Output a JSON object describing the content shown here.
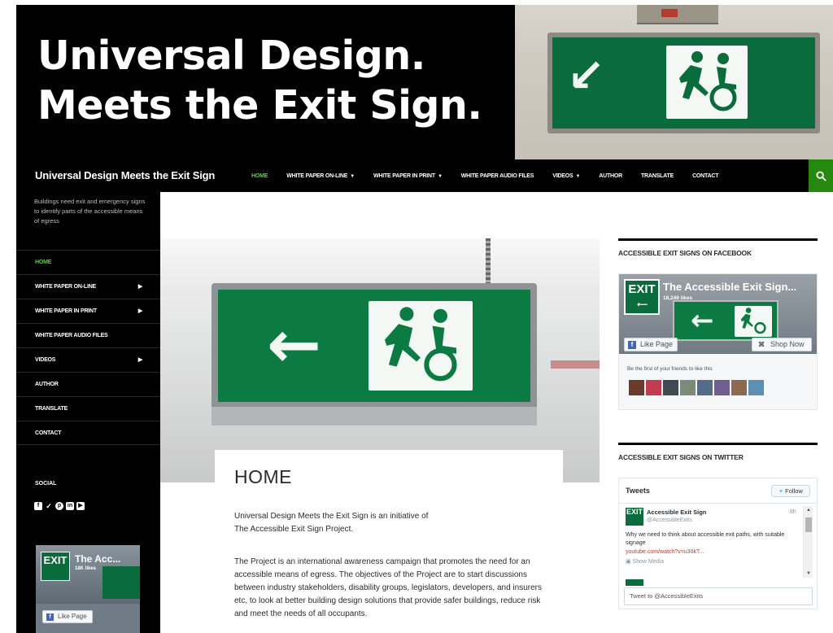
{
  "banner": {
    "title": "Universal Design.\nMeets the Exit Sign."
  },
  "site": {
    "title": "Universal Design Meets the Exit Sign",
    "tagline": "Buildings need exit and emergency signs to identify parts of the accessible means of egress"
  },
  "colors": {
    "accent": "#24890d",
    "active_link": "#55d737",
    "exit_green": "#0a6b3c"
  },
  "top_menu": [
    {
      "label": "HOME",
      "active": true,
      "has_submenu": false
    },
    {
      "label": "WHITE PAPER ON-LINE",
      "active": false,
      "has_submenu": true
    },
    {
      "label": "WHITE PAPER IN PRINT",
      "active": false,
      "has_submenu": true
    },
    {
      "label": "WHITE PAPER AUDIO FILES",
      "active": false,
      "has_submenu": false
    },
    {
      "label": "VIDEOS",
      "active": false,
      "has_submenu": true
    },
    {
      "label": "AUTHOR",
      "active": false,
      "has_submenu": false
    },
    {
      "label": "TRANSLATE",
      "active": false,
      "has_submenu": false
    },
    {
      "label": "CONTACT",
      "active": false,
      "has_submenu": false
    }
  ],
  "search_icon": "search-icon",
  "side_menu": [
    {
      "label": "HOME",
      "active": true,
      "has_submenu": false
    },
    {
      "label": "WHITE PAPER ON-LINE",
      "active": false,
      "has_submenu": true
    },
    {
      "label": "WHITE PAPER IN PRINT",
      "active": false,
      "has_submenu": true
    },
    {
      "label": "WHITE PAPER AUDIO FILES",
      "active": false,
      "has_submenu": false
    },
    {
      "label": "VIDEOS",
      "active": false,
      "has_submenu": true
    },
    {
      "label": "AUTHOR",
      "active": false,
      "has_submenu": false
    },
    {
      "label": "TRANSLATE",
      "active": false,
      "has_submenu": false
    },
    {
      "label": "CONTACT",
      "active": false,
      "has_submenu": false
    }
  ],
  "social": {
    "title": "SOCIAL",
    "icons": [
      "facebook-icon",
      "twitter-icon",
      "pinterest-icon",
      "linkedin-icon",
      "youtube-icon"
    ]
  },
  "side_fb": {
    "name": "The Acc...",
    "likes": "18K likes",
    "like_label": "Like Page",
    "logo_text": "EXIT"
  },
  "main": {
    "page_title": "HOME",
    "intro": "Universal Design Meets the Exit Sign is an initiative of\nThe Accessible Exit Sign Project.",
    "body": "The Project is an international awareness campaign that promotes the need for an accessible means of egress. The objectives of the Project are to start discussions between industry stakeholders, disability groups, legislators, developers, and insurers etc, to look at better building design solutions that provide safer buildings, reduce risk and meet the needs of all occupants."
  },
  "facebook_widget": {
    "title": "ACCESSIBLE EXIT SIGNS ON FACEBOOK",
    "page_name": "The Accessible Exit Sign...",
    "likes": "18,249 likes",
    "logo_text": "EXIT",
    "logo_sub": "⟵",
    "like_label": "Like Page",
    "shop_label": "Shop Now",
    "friends_text": "Be the first of your friends to like this",
    "faces": [
      "#6b3a2a",
      "#c43c52",
      "#3f4a55",
      "#7c8a7a",
      "#556b8a",
      "#6f5f8f",
      "#8b6a4f",
      "#5e8fb0"
    ]
  },
  "twitter_widget": {
    "title": "ACCESSIBLE EXIT SIGNS ON TWITTER",
    "header": "Tweets",
    "follow_label": "Follow",
    "tweet": {
      "avatar_text": "EXIT",
      "author": "Accessible Exit Sign",
      "handle": "@AccessibleExits",
      "time": "8h",
      "text": "Why we need to think about accessible exit paths, with suitable signage",
      "link": "youtube.com/watch?v=u30kT...",
      "media_label": "Show Media"
    },
    "compose_placeholder": "Tweet to @AccessibleExits"
  }
}
